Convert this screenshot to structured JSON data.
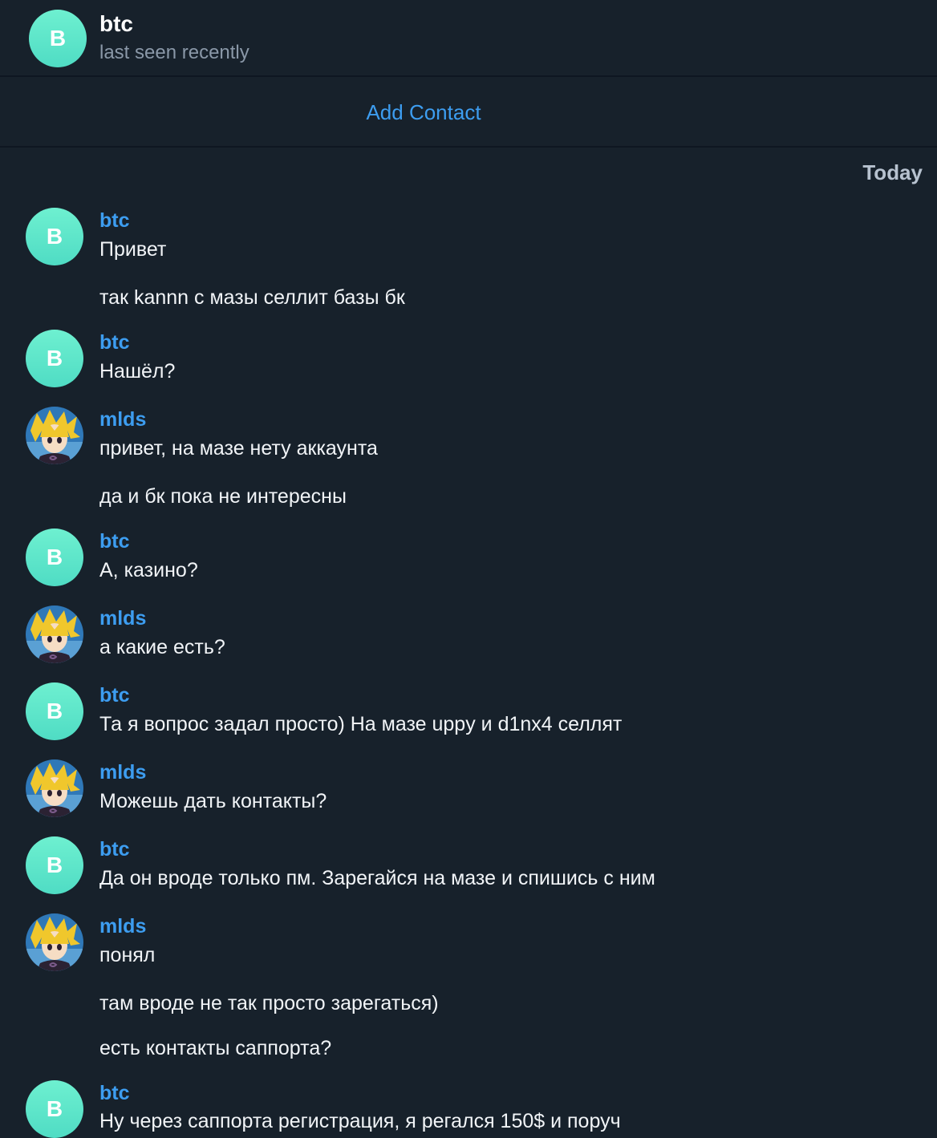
{
  "header": {
    "avatar_letter": "B",
    "title": "btc",
    "status": "last seen recently"
  },
  "action_bar": {
    "add_contact": "Add Contact"
  },
  "date_separator": "Today",
  "colors": {
    "background": "#17212b",
    "accent": "#3d9df0",
    "avatar_teal": "#5ee8cc"
  },
  "messages": [
    {
      "sender": "btc",
      "avatar": "B",
      "lines": [
        "Привет",
        "так kannn с мазы селлит базы бк"
      ]
    },
    {
      "sender": "btc",
      "avatar": "B",
      "lines": [
        "Нашёл?"
      ]
    },
    {
      "sender": "mlds",
      "avatar": "anime-character-avatar",
      "lines": [
        "привет, на мазе нету аккаунта",
        "да и бк пока не интересны"
      ]
    },
    {
      "sender": "btc",
      "avatar": "B",
      "lines": [
        "А, казино?"
      ]
    },
    {
      "sender": "mlds",
      "avatar": "anime-character-avatar",
      "lines": [
        "а какие есть?"
      ]
    },
    {
      "sender": "btc",
      "avatar": "B",
      "lines": [
        "Та я вопрос задал просто) На мазе uppy и d1nx4 селлят"
      ]
    },
    {
      "sender": "mlds",
      "avatar": "anime-character-avatar",
      "lines": [
        "Можешь дать контакты?"
      ]
    },
    {
      "sender": "btc",
      "avatar": "B",
      "lines": [
        "Да он вроде только пм. Зарегайся на мазе и спишись с ним"
      ]
    },
    {
      "sender": "mlds",
      "avatar": "anime-character-avatar",
      "lines": [
        "понял",
        "там вроде не так просто зарегаться)",
        "есть контакты саппорта?"
      ]
    },
    {
      "sender": "btc",
      "avatar": "B",
      "lines": [
        "Ну через саппорта регистрация, я регался 150$ и поруч"
      ]
    }
  ]
}
